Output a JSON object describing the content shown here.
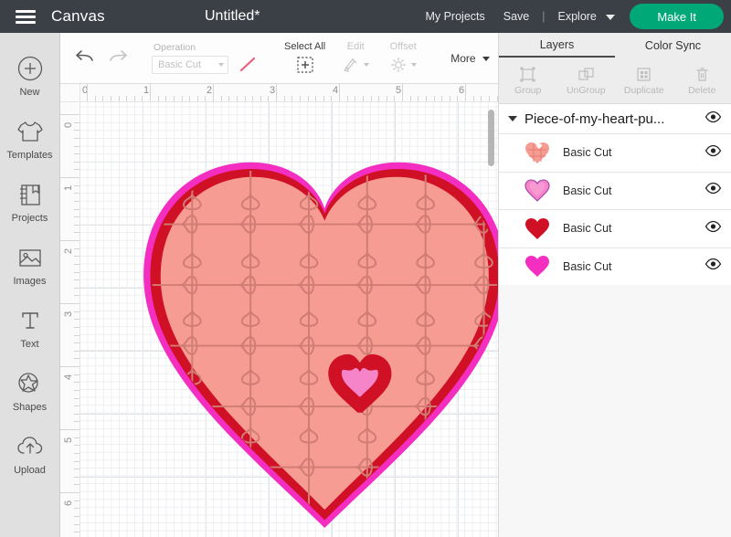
{
  "topbar": {
    "menu_icon": "hamburger-icon",
    "canvas_label": "Canvas",
    "document_title": "Untitled*",
    "my_projects": "My Projects",
    "save": "Save",
    "separator": "|",
    "explore": "Explore",
    "make_it": "Make It",
    "accent_green": "#00a878",
    "bar_color": "#3b3f46"
  },
  "sidebar": {
    "items": [
      {
        "label": "New",
        "icon": "plus-circle-icon"
      },
      {
        "label": "Templates",
        "icon": "tshirt-icon"
      },
      {
        "label": "Projects",
        "icon": "notebook-icon"
      },
      {
        "label": "Images",
        "icon": "picture-icon"
      },
      {
        "label": "Text",
        "icon": "text-t-icon"
      },
      {
        "label": "Shapes",
        "icon": "shapes-icon"
      },
      {
        "label": "Upload",
        "icon": "cloud-upload-icon"
      }
    ]
  },
  "toolbar": {
    "undo": "undo-icon",
    "redo": "redo-icon",
    "operation_label": "Operation",
    "operation_value": "Basic Cut",
    "swatch_color": "#e8607a",
    "select_all": "Select All",
    "edit": "Edit",
    "offset": "Offset",
    "more": "More"
  },
  "canvas": {
    "ruler_h_marks": [
      "0",
      "1",
      "2",
      "3",
      "4",
      "5",
      "6"
    ],
    "ruler_v_marks": [
      "0",
      "1",
      "2",
      "3",
      "4",
      "5",
      "6"
    ],
    "artwork_name": "puzzle-heart-artwork",
    "colors": {
      "outer_magenta": "#ef2fc0",
      "mid_red": "#cf1025",
      "fill_salmon": "#f79c92",
      "puzzle_line": "#cf7d75",
      "small_heart_red": "#cf1025",
      "small_heart_pink": "#f585c8"
    }
  },
  "right_panel": {
    "tabs": [
      {
        "label": "Layers",
        "active": true
      },
      {
        "label": "Color Sync",
        "active": false
      }
    ],
    "tools": [
      {
        "label": "Group",
        "icon": "group-icon"
      },
      {
        "label": "UnGroup",
        "icon": "ungroup-icon"
      },
      {
        "label": "Duplicate",
        "icon": "duplicate-icon"
      },
      {
        "label": "Delete",
        "icon": "trash-icon"
      }
    ],
    "group": {
      "title": "Piece-of-my-heart-pu...",
      "visibility_icon": "eye-icon"
    },
    "layers": [
      {
        "label": "Basic Cut",
        "color": "#f79c92",
        "style": "puzzle",
        "visibility_icon": "eye-icon"
      },
      {
        "label": "Basic Cut",
        "color": "#f585c8",
        "style": "outlined",
        "visibility_icon": "eye-icon"
      },
      {
        "label": "Basic Cut",
        "color": "#cf1025",
        "style": "solid",
        "visibility_icon": "eye-icon"
      },
      {
        "label": "Basic Cut",
        "color": "#f32ec0",
        "style": "solid",
        "visibility_icon": "eye-icon"
      }
    ]
  }
}
